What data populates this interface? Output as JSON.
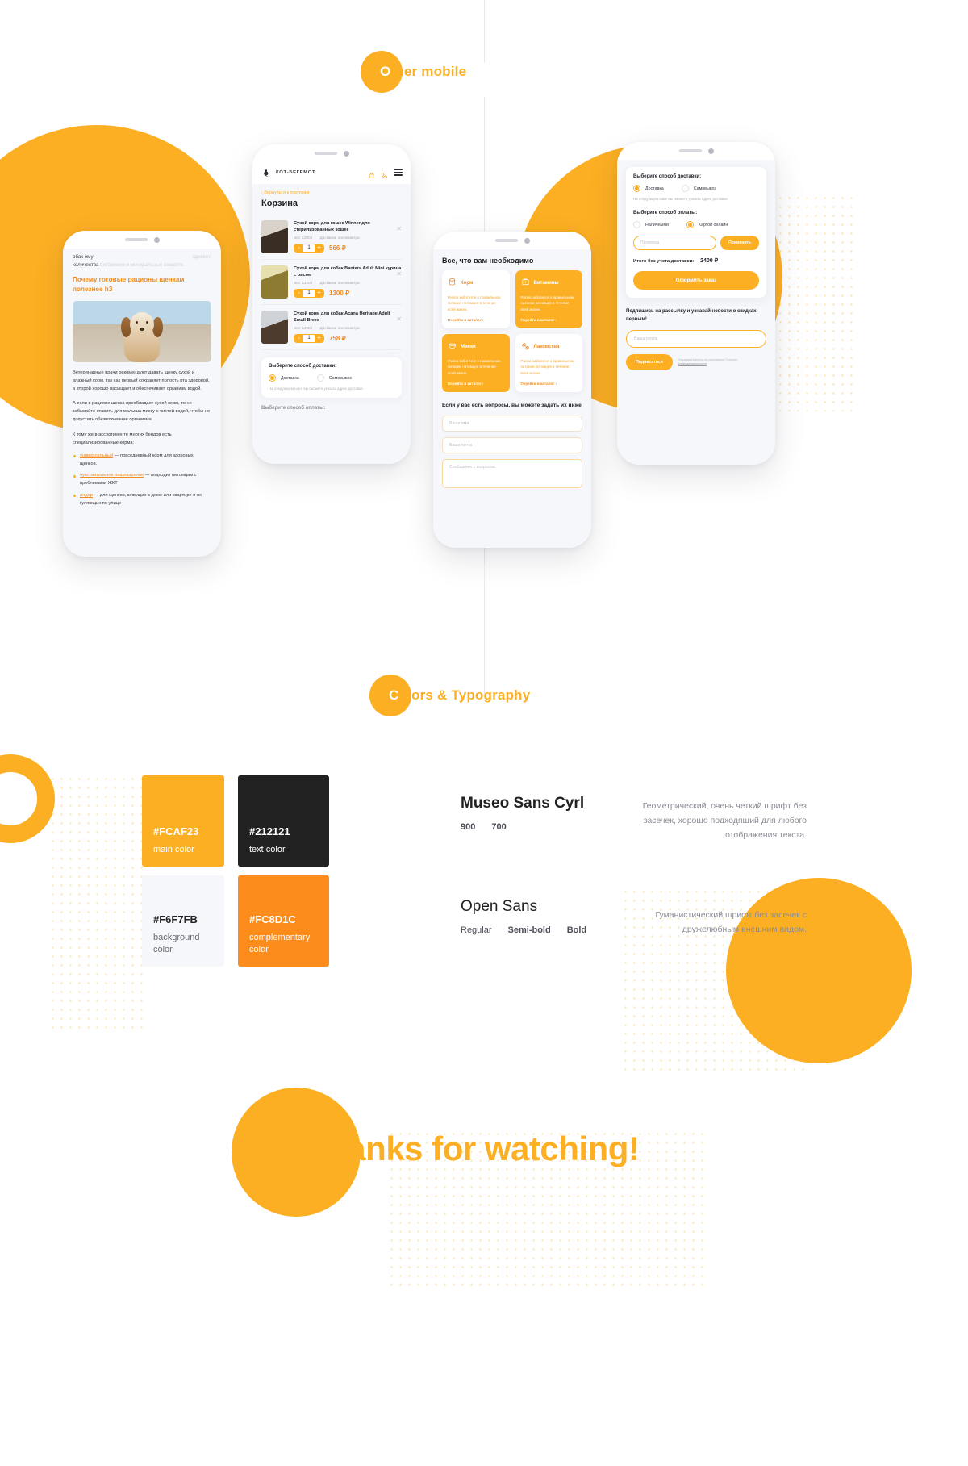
{
  "sections": {
    "mobile": {
      "label_first": "O",
      "label_rest": "ther mobile",
      "full": "Other mobile"
    },
    "colors": {
      "label_first": "C",
      "label_rest": "olors & Typography",
      "full": "Colors & Typography"
    },
    "thanks": "Thanks for watching!"
  },
  "phone_article": {
    "top_faded_line1": "обак ему",
    "top_faded_line1b": "одимого",
    "top_faded_line2": "количества",
    "top_faded_line2b": "витаминов и минеральных веществ.",
    "heading": "Почему готовые рационы щенкам полезнее h3",
    "photo_alt": "puppy-photo",
    "paragraph_1": "Ветеринарные врачи рекомендуют давать щенку сухой и влажный корм, так как первый сохраняет полость рта здоровой, а второй хорошо насыщает и обеспечивает организм водой.",
    "paragraph_2": "А если в рационе щенка преобладает сухой корм, то не забывайте ставить для малыша миску с чистой водой, чтобы не допустить обезвоживание организма.",
    "paragraph_3": "К тому же в ассортименте многих бендов есть специализированные корма:",
    "bullets": [
      {
        "link": "универсальный",
        "rest": " — повседневный корм для здоровых щенков."
      },
      {
        "link": "чувствительное пищеварение",
        "rest": " — подходит питомцам с проблемами ЖКТ"
      },
      {
        "link": "индор",
        "rest": " — для щенков, живущих в доме или квартире и не гуляющих по улице"
      }
    ]
  },
  "phone_cart": {
    "brand": "КОТ-БЕГЕМОТ",
    "icons": {
      "bag": "shopping-bag-icon",
      "phone": "phone-icon",
      "menu": "hamburger-menu-icon"
    },
    "back_link": "‹  Вернуться к покупкам",
    "title": "Корзина",
    "items": [
      {
        "name": "Сухой корм для кошек Winner для стерилизованных кошек",
        "weight": "Вес: 1300 г",
        "delivery": "Доставка: послезавтра",
        "qty": "1",
        "price": "566 ₽"
      },
      {
        "name": "Сухой корм для собак Banters Adult Mini курица с рисом",
        "weight": "Вес: 1400 г",
        "delivery": "Доставка: послезавтра",
        "qty": "1",
        "price": "1300 ₽"
      },
      {
        "name": "Сухой корм для собак Acana Heritage Adult Small Breed",
        "weight": "Вес: 1450 г",
        "delivery": "Доставка: послезавтра",
        "qty": "1",
        "price": "758 ₽"
      }
    ],
    "delivery_section_title": "Выберите способ доставки:",
    "delivery_option_1": "Доставка",
    "delivery_option_2": "Самовывоз",
    "delivery_hint": "На следующем шаге вы сможете указать адрес доставки",
    "payment_section_title": "Выберите способ оплаты:"
  },
  "phone_categories": {
    "title": "Все, что вам необходимо",
    "cards": [
      {
        "icon": "food-can-icon",
        "name": "Корм",
        "desc": "Purina заботится о правильном питании питомцев в течение всей жизни.",
        "link": "Перейти в каталог  ›",
        "style": "light"
      },
      {
        "icon": "vitamins-icon",
        "name": "Витамины",
        "desc": "Purina заботится о правильном питании питомцев в течение всей жизни.",
        "link": "Перейти в каталог  ›",
        "style": "accent"
      },
      {
        "icon": "bowl-icon",
        "name": "Миски",
        "desc": "Purina заботится о правильном питании питомцев в течение всей жизни.",
        "link": "Перейти в каталог  ›",
        "style": "accent"
      },
      {
        "icon": "bone-icon",
        "name": "Лакомства",
        "desc": "Purina заботится о правильном питании питомцев в течение всей жизни.",
        "link": "Перейти в каталог  ›",
        "style": "light"
      }
    ],
    "question_title": "Если у вас есть вопросы, вы можете задать их ниже",
    "field_name": "Ваше имя",
    "field_email": "Ваша почта",
    "field_message": "Сообщение с вопросом"
  },
  "phone_checkout": {
    "delivery_title": "Выберите способ доставки:",
    "delivery_option_1": "Доставка",
    "delivery_option_2": "Самовывоз",
    "delivery_hint": "На следующем шаге вы сможете указать адрес доставки",
    "payment_title": "Выберите способ оплаты:",
    "payment_option_1": "Наличными",
    "payment_option_2": "Картой онлайн",
    "promo_placeholder": "Промокод",
    "promo_button": "Применить",
    "total_label": "Итого без учета доставки:",
    "total_value": "2400 ₽",
    "cta": "Оформить заказ",
    "news_title": "Подпишись на рассылку и узнавай новости о скидках первым!",
    "news_placeholder": "Ваша почта",
    "news_button": "Подписаться",
    "news_note_1": "Нажимая на кнопку вы принимаете Политику",
    "news_note_2": "конфиденциальности"
  },
  "palette": [
    {
      "hex": "#FCAF23",
      "name": "main color"
    },
    {
      "hex": "#212121",
      "name": "text color"
    },
    {
      "hex": "#F6F7FB",
      "name": "background color"
    },
    {
      "hex": "#FC8D1C",
      "name": "complementary color"
    }
  ],
  "typography": [
    {
      "family": "Museo Sans Cyrl",
      "weights": [
        "900",
        "700"
      ],
      "desc": "Геометрический, очень четкий шрифт без засечек, хорошо подходящий для любого отображения текста."
    },
    {
      "family": "Open Sans",
      "weights": [
        "Regular",
        "Semi-bold",
        "Bold"
      ],
      "desc": "Гуманистический шрифт без засечек с дружелюбным внешним видом."
    }
  ]
}
